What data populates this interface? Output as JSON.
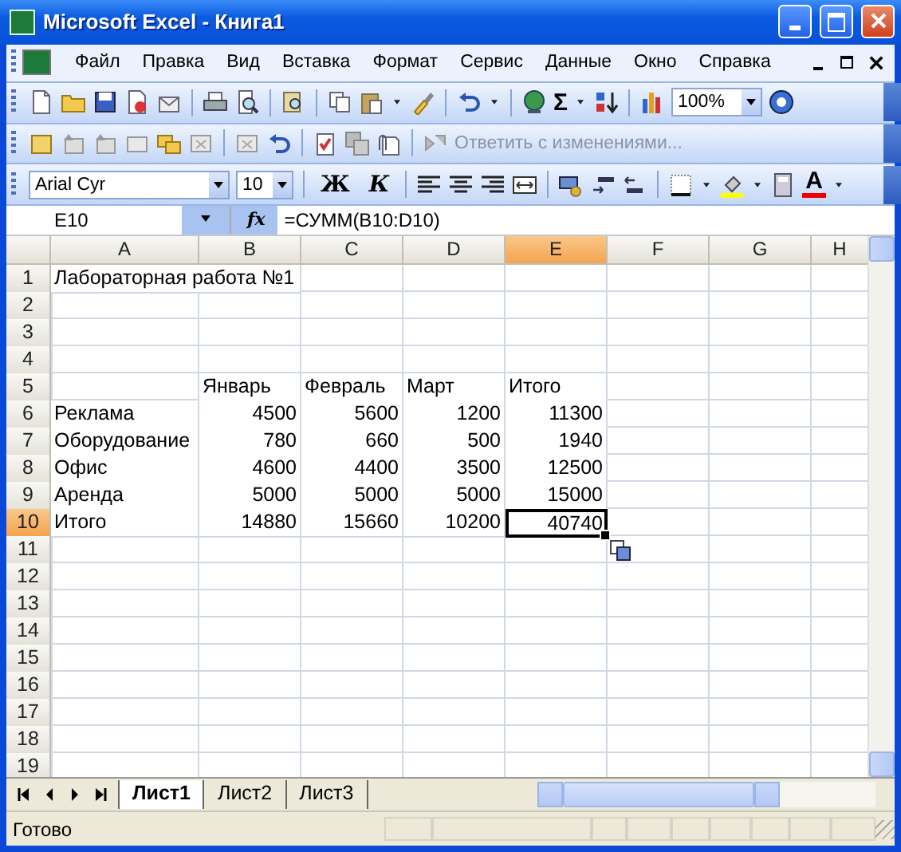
{
  "window": {
    "title": "Microsoft Excel - Книга1"
  },
  "menu": [
    {
      "label": "Файл"
    },
    {
      "label": "Правка"
    },
    {
      "label": "Вид"
    },
    {
      "label": "Вставка"
    },
    {
      "label": "Формат"
    },
    {
      "label": "Сервис"
    },
    {
      "label": "Данные"
    },
    {
      "label": "Окно"
    },
    {
      "label": "Справка"
    }
  ],
  "standard_toolbar": {
    "sum": "Σ",
    "zoom": "100%"
  },
  "review_toolbar": {
    "reply": "Ответить с изменениями..."
  },
  "formatting_toolbar": {
    "font": "Arial Cyr",
    "size": "10",
    "bold": "Ж",
    "italic": "К",
    "font_color": "A"
  },
  "formula_bar": {
    "name_box": "E10",
    "fx": "fx",
    "formula": "=СУММ(B10:D10)"
  },
  "columns": [
    {
      "label": "A",
      "selected": false
    },
    {
      "label": "B",
      "selected": false
    },
    {
      "label": "C",
      "selected": false
    },
    {
      "label": "D",
      "selected": false
    },
    {
      "label": "E",
      "selected": true
    },
    {
      "label": "F",
      "selected": false
    },
    {
      "label": "G",
      "selected": false
    },
    {
      "label": "H",
      "selected": false
    }
  ],
  "rows": [
    {
      "header": "1",
      "selected": false,
      "kind": "title",
      "cells": [
        "Лабораторная работа №1"
      ]
    },
    {
      "header": "2",
      "selected": false,
      "kind": "empty",
      "cells": []
    },
    {
      "header": "3",
      "selected": false,
      "kind": "empty",
      "cells": []
    },
    {
      "header": "4",
      "selected": false,
      "kind": "empty",
      "cells": []
    },
    {
      "header": "5",
      "selected": false,
      "kind": "heading",
      "cells": [
        "",
        "Январь",
        "Февраль",
        "Март",
        "Итого"
      ]
    },
    {
      "header": "6",
      "selected": false,
      "kind": "numbers",
      "cells": [
        "Реклама",
        "4500",
        "5600",
        "1200",
        "11300"
      ]
    },
    {
      "header": "7",
      "selected": false,
      "kind": "numbers",
      "cells": [
        "Оборудование",
        "780",
        "660",
        "500",
        "1940"
      ]
    },
    {
      "header": "8",
      "selected": false,
      "kind": "numbers",
      "cells": [
        "Офис",
        "4600",
        "4400",
        "3500",
        "12500"
      ]
    },
    {
      "header": "9",
      "selected": false,
      "kind": "numbers",
      "cells": [
        "Аренда",
        "5000",
        "5000",
        "5000",
        "15000"
      ]
    },
    {
      "header": "10",
      "selected": true,
      "kind": "numbers",
      "cells": [
        "Итого",
        "14880",
        "15660",
        "10200",
        "40740"
      ]
    },
    {
      "header": "11",
      "selected": false,
      "kind": "empty",
      "cells": []
    },
    {
      "header": "12",
      "selected": false,
      "kind": "empty",
      "cells": []
    },
    {
      "header": "13",
      "selected": false,
      "kind": "empty",
      "cells": []
    },
    {
      "header": "14",
      "selected": false,
      "kind": "empty",
      "cells": []
    },
    {
      "header": "15",
      "selected": false,
      "kind": "empty",
      "cells": []
    },
    {
      "header": "16",
      "selected": false,
      "kind": "empty",
      "cells": []
    },
    {
      "header": "17",
      "selected": false,
      "kind": "empty",
      "cells": []
    },
    {
      "header": "18",
      "selected": false,
      "kind": "empty",
      "cells": []
    },
    {
      "header": "19",
      "selected": false,
      "kind": "empty",
      "cells": []
    }
  ],
  "sheet_tabs": [
    {
      "label": "Лист1",
      "selected": true
    },
    {
      "label": "Лист2",
      "selected": false
    },
    {
      "label": "Лист3",
      "selected": false
    }
  ],
  "status_bar": {
    "text": "Готово"
  }
}
